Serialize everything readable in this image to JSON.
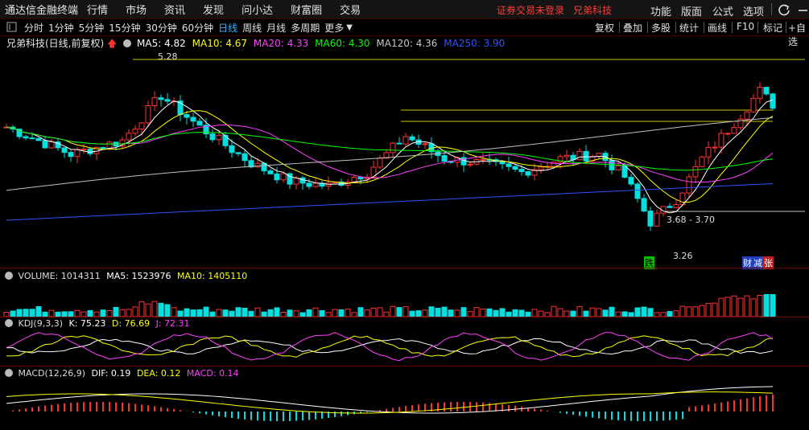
{
  "app": {
    "title": "通达信金融终端"
  },
  "menu": [
    "行情",
    "市场",
    "资讯",
    "发现",
    "问小达",
    "财富圈",
    "交易"
  ],
  "notice": "证券交易未登录",
  "stock_title": "兄弟科技",
  "right_menu": [
    "功能",
    "版面",
    "公式",
    "选项"
  ],
  "periods": [
    "分时",
    "1分钟",
    "5分钟",
    "15分钟",
    "30分钟",
    "60分钟",
    "日线",
    "周线",
    "月线",
    "多周期",
    "更多"
  ],
  "active_period": "日线",
  "tools": [
    "复权",
    "叠加",
    "多股",
    "统计",
    "画线",
    "F10",
    "标记",
    "+自选"
  ],
  "info": {
    "name": "兄弟科技(日线,前复权)",
    "ma5": "MA5: 4.82",
    "ma10": "MA10: 4.67",
    "ma20": "MA20: 4.33",
    "ma60": "MA60: 4.30",
    "ma120": "MA120: 4.36",
    "ma250": "MA250: 3.90"
  },
  "annotations": {
    "high": "5.28",
    "low": "3.26",
    "range": "3.68 - 3.70",
    "tag_die": "跌",
    "tag_cai": "财",
    "tag_jian": "减",
    "tag_zhang": "张"
  },
  "volume": {
    "label": "VOLUME: 1014311",
    "ma5": "MA5: 1523976",
    "ma10": "MA10: 1405110"
  },
  "kdj": {
    "label": "KDJ(9,3,3)",
    "k": "K: 75.23",
    "d": "D: 76.69",
    "j": "J: 72.31"
  },
  "macd": {
    "label": "MACD(12,26,9)",
    "dif": "DIF: 0.19",
    "dea": "DEA: 0.12",
    "macd": "MACD: 0.14"
  },
  "colors": {
    "up": "#ff3232",
    "down": "#00e0e0",
    "ma5": "#ffffff",
    "ma10": "#ffff00",
    "ma20": "#ff40ff",
    "ma60": "#00ff00",
    "ma120": "#c0c0c0",
    "ma250": "#3050ff",
    "active": "#3fb0ff"
  }
}
